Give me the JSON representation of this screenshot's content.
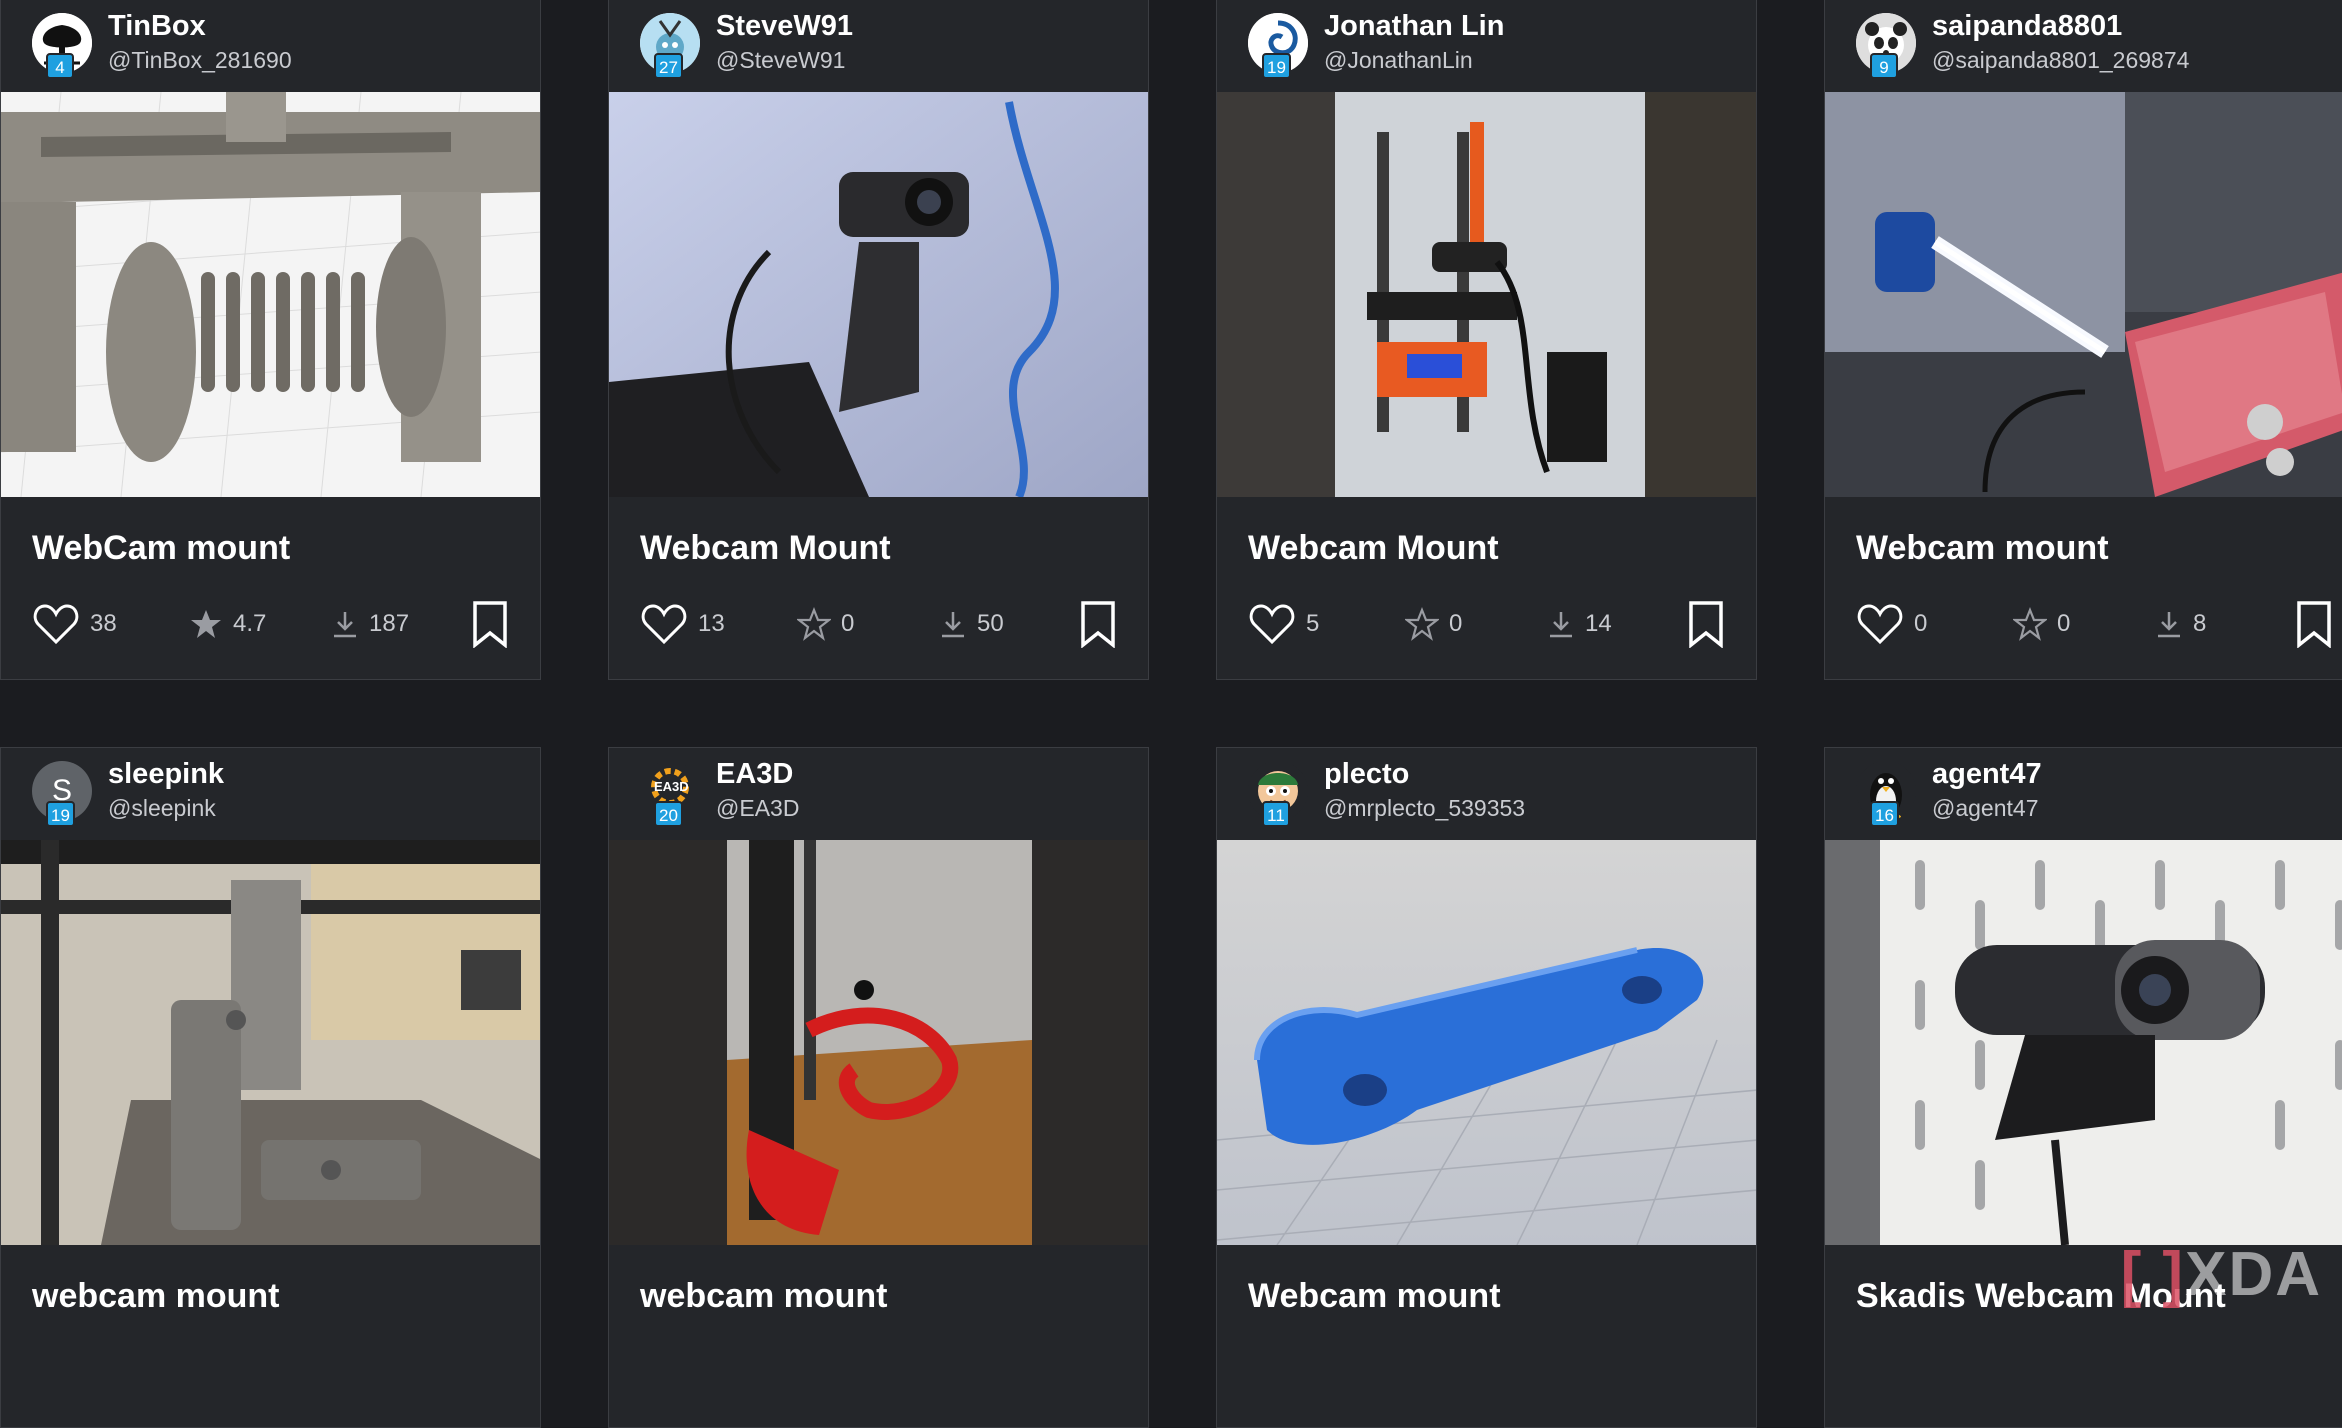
{
  "cards": [
    {
      "username": "TinBox",
      "handle": "@TinBox_281690",
      "level": "4",
      "title": "WebCam mount",
      "likes": "38",
      "rating": "4.7",
      "rating_filled": true,
      "downloads": "187",
      "avatar_icon": "tree-icon",
      "thumb_icon": "cad-clamp-render-icon"
    },
    {
      "username": "SteveW91",
      "handle": "@SteveW91",
      "level": "27",
      "title": "Webcam Mount",
      "likes": "13",
      "rating": "0",
      "rating_filled": false,
      "downloads": "50",
      "avatar_icon": "robot-icon",
      "thumb_icon": "webcam-photo-icon"
    },
    {
      "username": "Jonathan Lin",
      "handle": "@JonathanLin",
      "level": "19",
      "title": "Webcam Mount",
      "likes": "5",
      "rating": "0",
      "rating_filled": false,
      "downloads": "14",
      "avatar_icon": "spiral-logo-icon",
      "thumb_icon": "printer-enclosure-photo-icon"
    },
    {
      "username": "saipanda8801",
      "handle": "@saipanda8801_269874",
      "level": "9",
      "title": "Webcam mount",
      "likes": "0",
      "rating": "0",
      "rating_filled": false,
      "downloads": "8",
      "avatar_icon": "panda-icon",
      "thumb_icon": "led-webcam-photo-icon"
    },
    {
      "username": "sleepink",
      "handle": "@sleepink",
      "level": "19",
      "title": "webcam mount",
      "avatar_letter": "S",
      "avatar_icon": "letter-avatar-icon",
      "thumb_icon": "printer-arm-photo-icon"
    },
    {
      "username": "EA3D",
      "handle": "@EA3D",
      "level": "20",
      "title": "webcam mount",
      "avatar_logo_text": "EA3D",
      "avatar_icon": "gear-logo-icon",
      "thumb_icon": "red-mount-photo-icon"
    },
    {
      "username": "plecto",
      "handle": "@mrplecto_539353",
      "level": "11",
      "title": "Webcam mount",
      "avatar_icon": "cartoon-face-icon",
      "thumb_icon": "blue-arm-render-icon"
    },
    {
      "username": "agent47",
      "handle": "@agent47",
      "level": "16",
      "title": "Skadis Webcam Mount",
      "avatar_icon": "penguin-icon",
      "thumb_icon": "pegboard-webcam-photo-icon"
    }
  ],
  "watermark": {
    "text": "XDA",
    "bracket": "[ ]"
  },
  "colors": {
    "background": "#1b1c20",
    "card": "#24262a",
    "badge": "#1fa0e0",
    "muted_text": "#c9cbd0"
  }
}
